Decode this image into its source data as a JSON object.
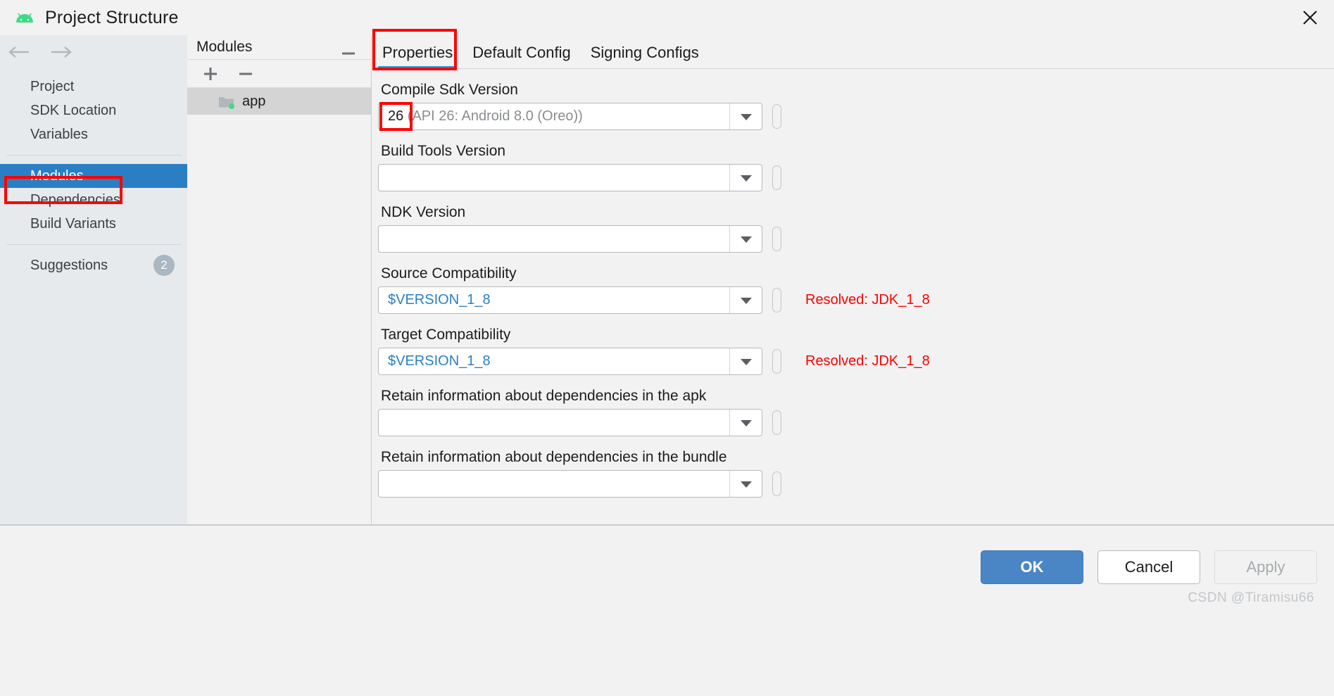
{
  "window": {
    "title": "Project Structure",
    "app_icon": "android-icon",
    "close_icon": "close-icon"
  },
  "nav": {
    "back_icon": "arrow-left-icon",
    "forward_icon": "arrow-right-icon"
  },
  "sidebar": {
    "items": [
      {
        "label": "Project",
        "selected": false
      },
      {
        "label": "SDK Location",
        "selected": false
      },
      {
        "label": "Variables",
        "selected": false
      },
      {
        "label": "Modules",
        "selected": true
      },
      {
        "label": "Dependencies",
        "selected": false
      },
      {
        "label": "Build Variants",
        "selected": false
      }
    ],
    "suggestions": {
      "label": "Suggestions",
      "count": "2"
    }
  },
  "modules_panel": {
    "header": "Modules",
    "add_icon": "plus-icon",
    "remove_icon": "minus-icon",
    "items": [
      {
        "label": "app",
        "icon": "folder-icon"
      }
    ]
  },
  "tabs": {
    "minus_icon": "minus-icon",
    "items": [
      {
        "label": "Properties",
        "active": true
      },
      {
        "label": "Default Config",
        "active": false
      },
      {
        "label": "Signing Configs",
        "active": false
      }
    ]
  },
  "properties": {
    "fields": [
      {
        "label": "Compile Sdk Version",
        "value_strong": "26",
        "value_dim": " (API 26: Android 8.0 (Oreo))",
        "value": "",
        "blue": false,
        "resolved": ""
      },
      {
        "label": "Build Tools Version",
        "value_strong": "",
        "value_dim": "",
        "value": "",
        "blue": false,
        "resolved": ""
      },
      {
        "label": "NDK Version",
        "value_strong": "",
        "value_dim": "",
        "value": "",
        "blue": false,
        "resolved": ""
      },
      {
        "label": "Source Compatibility",
        "value_strong": "",
        "value_dim": "",
        "value": "$VERSION_1_8",
        "blue": true,
        "resolved": "Resolved: JDK_1_8"
      },
      {
        "label": "Target Compatibility",
        "value_strong": "",
        "value_dim": "",
        "value": "$VERSION_1_8",
        "blue": true,
        "resolved": "Resolved: JDK_1_8"
      },
      {
        "label": "Retain information about dependencies in the apk",
        "value_strong": "",
        "value_dim": "",
        "value": "",
        "blue": false,
        "resolved": ""
      },
      {
        "label": "Retain information about dependencies in the bundle",
        "value_strong": "",
        "value_dim": "",
        "value": "",
        "blue": false,
        "resolved": ""
      }
    ],
    "dropdown_icon": "chevron-down-icon"
  },
  "footer": {
    "ok": "OK",
    "cancel": "Cancel",
    "apply": "Apply",
    "watermark": "CSDN @Tiramisu66"
  },
  "annotations": {
    "accent_red": "#ff0000",
    "selection_blue": "#2a7fc4"
  }
}
